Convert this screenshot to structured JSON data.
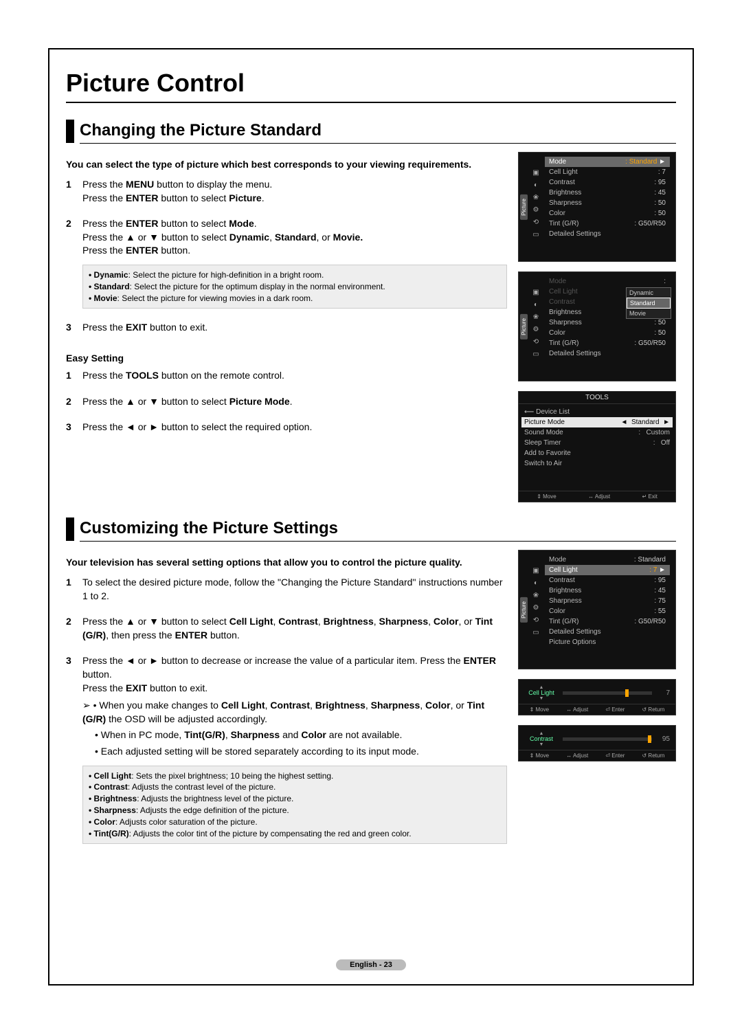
{
  "title": "Picture Control",
  "section1": {
    "heading": "Changing the Picture Standard",
    "intro": "You can select the type of picture which best corresponds to your viewing requirements.",
    "step1": "Press the MENU button to display the menu. Press the ENTER button to select Picture.",
    "step2_l1": "Press the ENTER button to select Mode.",
    "step2_l2": "Press the ▲ or ▼ button to select Dynamic, Standard, or Movie.",
    "step2_l3": "Press the ENTER button.",
    "step2_b1": "• Dynamic: Select the picture for high-definition in a bright room.",
    "step2_b2": "• Standard: Select the picture for the optimum display in the normal environment.",
    "step2_b3": "• Movie: Select the picture for viewing movies in a dark room.",
    "step3": "Press the EXIT button to exit.",
    "easy_title": "Easy Setting",
    "easy1": "Press the TOOLS button on the remote control.",
    "easy2": "Press the ▲ or ▼ button to select Picture Mode.",
    "easy3": "Press the ◄ or ► button to select the required option."
  },
  "section2": {
    "heading": "Customizing the Picture Settings",
    "intro": "Your television has several setting options that allow you to control the picture quality.",
    "step1": "To select the desired picture mode, follow the \"Changing the Picture Standard\" instructions number 1 to 2.",
    "step2": "Press the ▲ or ▼ button to select Cell Light, Contrast, Brightness, Sharpness, Color, or Tint (G/R), then press the ENTER button.",
    "step3_l1": "Press the ◄ or ► button to decrease or increase the value of a particular item. Press the ENTER button.",
    "step3_l2": "Press the EXIT button to exit.",
    "step3_n1": "➢ • When you make changes to Cell Light, Contrast, Brightness, Sharpness, Color, or Tint (G/R) the OSD will be adjusted accordingly.",
    "step3_n2": "• When in PC mode, Tint(G/R), Sharpness and Color are not available.",
    "step3_n3": "• Each adjusted setting will be stored separately according to its input mode.",
    "def_cell": "• Cell Light: Sets the pixel brightness; 10 being the highest setting.",
    "def_contrast": "• Contrast: Adjusts the contrast level of the picture.",
    "def_brightness": "• Brightness: Adjusts the brightness level of the picture.",
    "def_sharpness": "• Sharpness: Adjusts the edge definition of the picture.",
    "def_color": "• Color: Adjusts color saturation of the picture.",
    "def_tint": "• Tint(G/R): Adjusts the color tint of the picture by compensating the red and green color."
  },
  "osd1": {
    "side": "Picture",
    "r1l": "Mode",
    "r1v": ": Standard",
    "r2l": "Cell Light",
    "r2v": ": 7",
    "r3l": "Contrast",
    "r3v": ": 95",
    "r4l": "Brightness",
    "r4v": ": 45",
    "r5l": "Sharpness",
    "r5v": ": 50",
    "r6l": "Color",
    "r6v": ": 50",
    "r7l": "Tint (G/R)",
    "r7v": ": G50/R50",
    "r8l": "Detailed Settings"
  },
  "osd2": {
    "side": "Picture",
    "r1l": "Mode",
    "r1v": ":",
    "r2l": "Cell Light",
    "r2v": "",
    "r3l": "Contrast",
    "r3v": "",
    "r4l": "Brightness",
    "r4v": ": 45",
    "r5l": "Sharpness",
    "r5v": ": 50",
    "r6l": "Color",
    "r6v": ": 50",
    "r7l": "Tint (G/R)",
    "r7v": ": G50/R50",
    "r8l": "Detailed Settings",
    "d1": "Dynamic",
    "d2": "Standard",
    "d3": "Movie"
  },
  "tools": {
    "title": "TOOLS",
    "r1l": "Device List",
    "r2l": "Picture Mode",
    "r2v": "Standard",
    "r3l": "Sound Mode",
    "r3v": "Custom",
    "r4l": "Sleep Timer",
    "r4v": "Off",
    "r5l": "Add to Favorite",
    "r6l": "Switch to Air",
    "f1": "⇕ Move",
    "f2": "↔ Adjust",
    "f3": "↵ Exit"
  },
  "osd3": {
    "side": "Picture",
    "r1l": "Mode",
    "r1v": ": Standard",
    "r2l": "Cell Light",
    "r2v": ": 7",
    "r3l": "Contrast",
    "r3v": ": 95",
    "r4l": "Brightness",
    "r4v": ": 45",
    "r5l": "Sharpness",
    "r5v": ": 75",
    "r6l": "Color",
    "r6v": ": 55",
    "r7l": "Tint (G/R)",
    "r7v": ": G50/R50",
    "r8l": "Detailed Settings",
    "r9l": "Picture Options"
  },
  "slider1": {
    "name": "Cell Light",
    "val": "7",
    "pct": 70
  },
  "slider2": {
    "name": "Contrast",
    "val": "95",
    "pct": 95
  },
  "sfoot": {
    "f1": "⇕ Move",
    "f2": "↔ Adjust",
    "f3": "⏎ Enter",
    "f4": "↺ Return"
  },
  "footer": "English - 23"
}
